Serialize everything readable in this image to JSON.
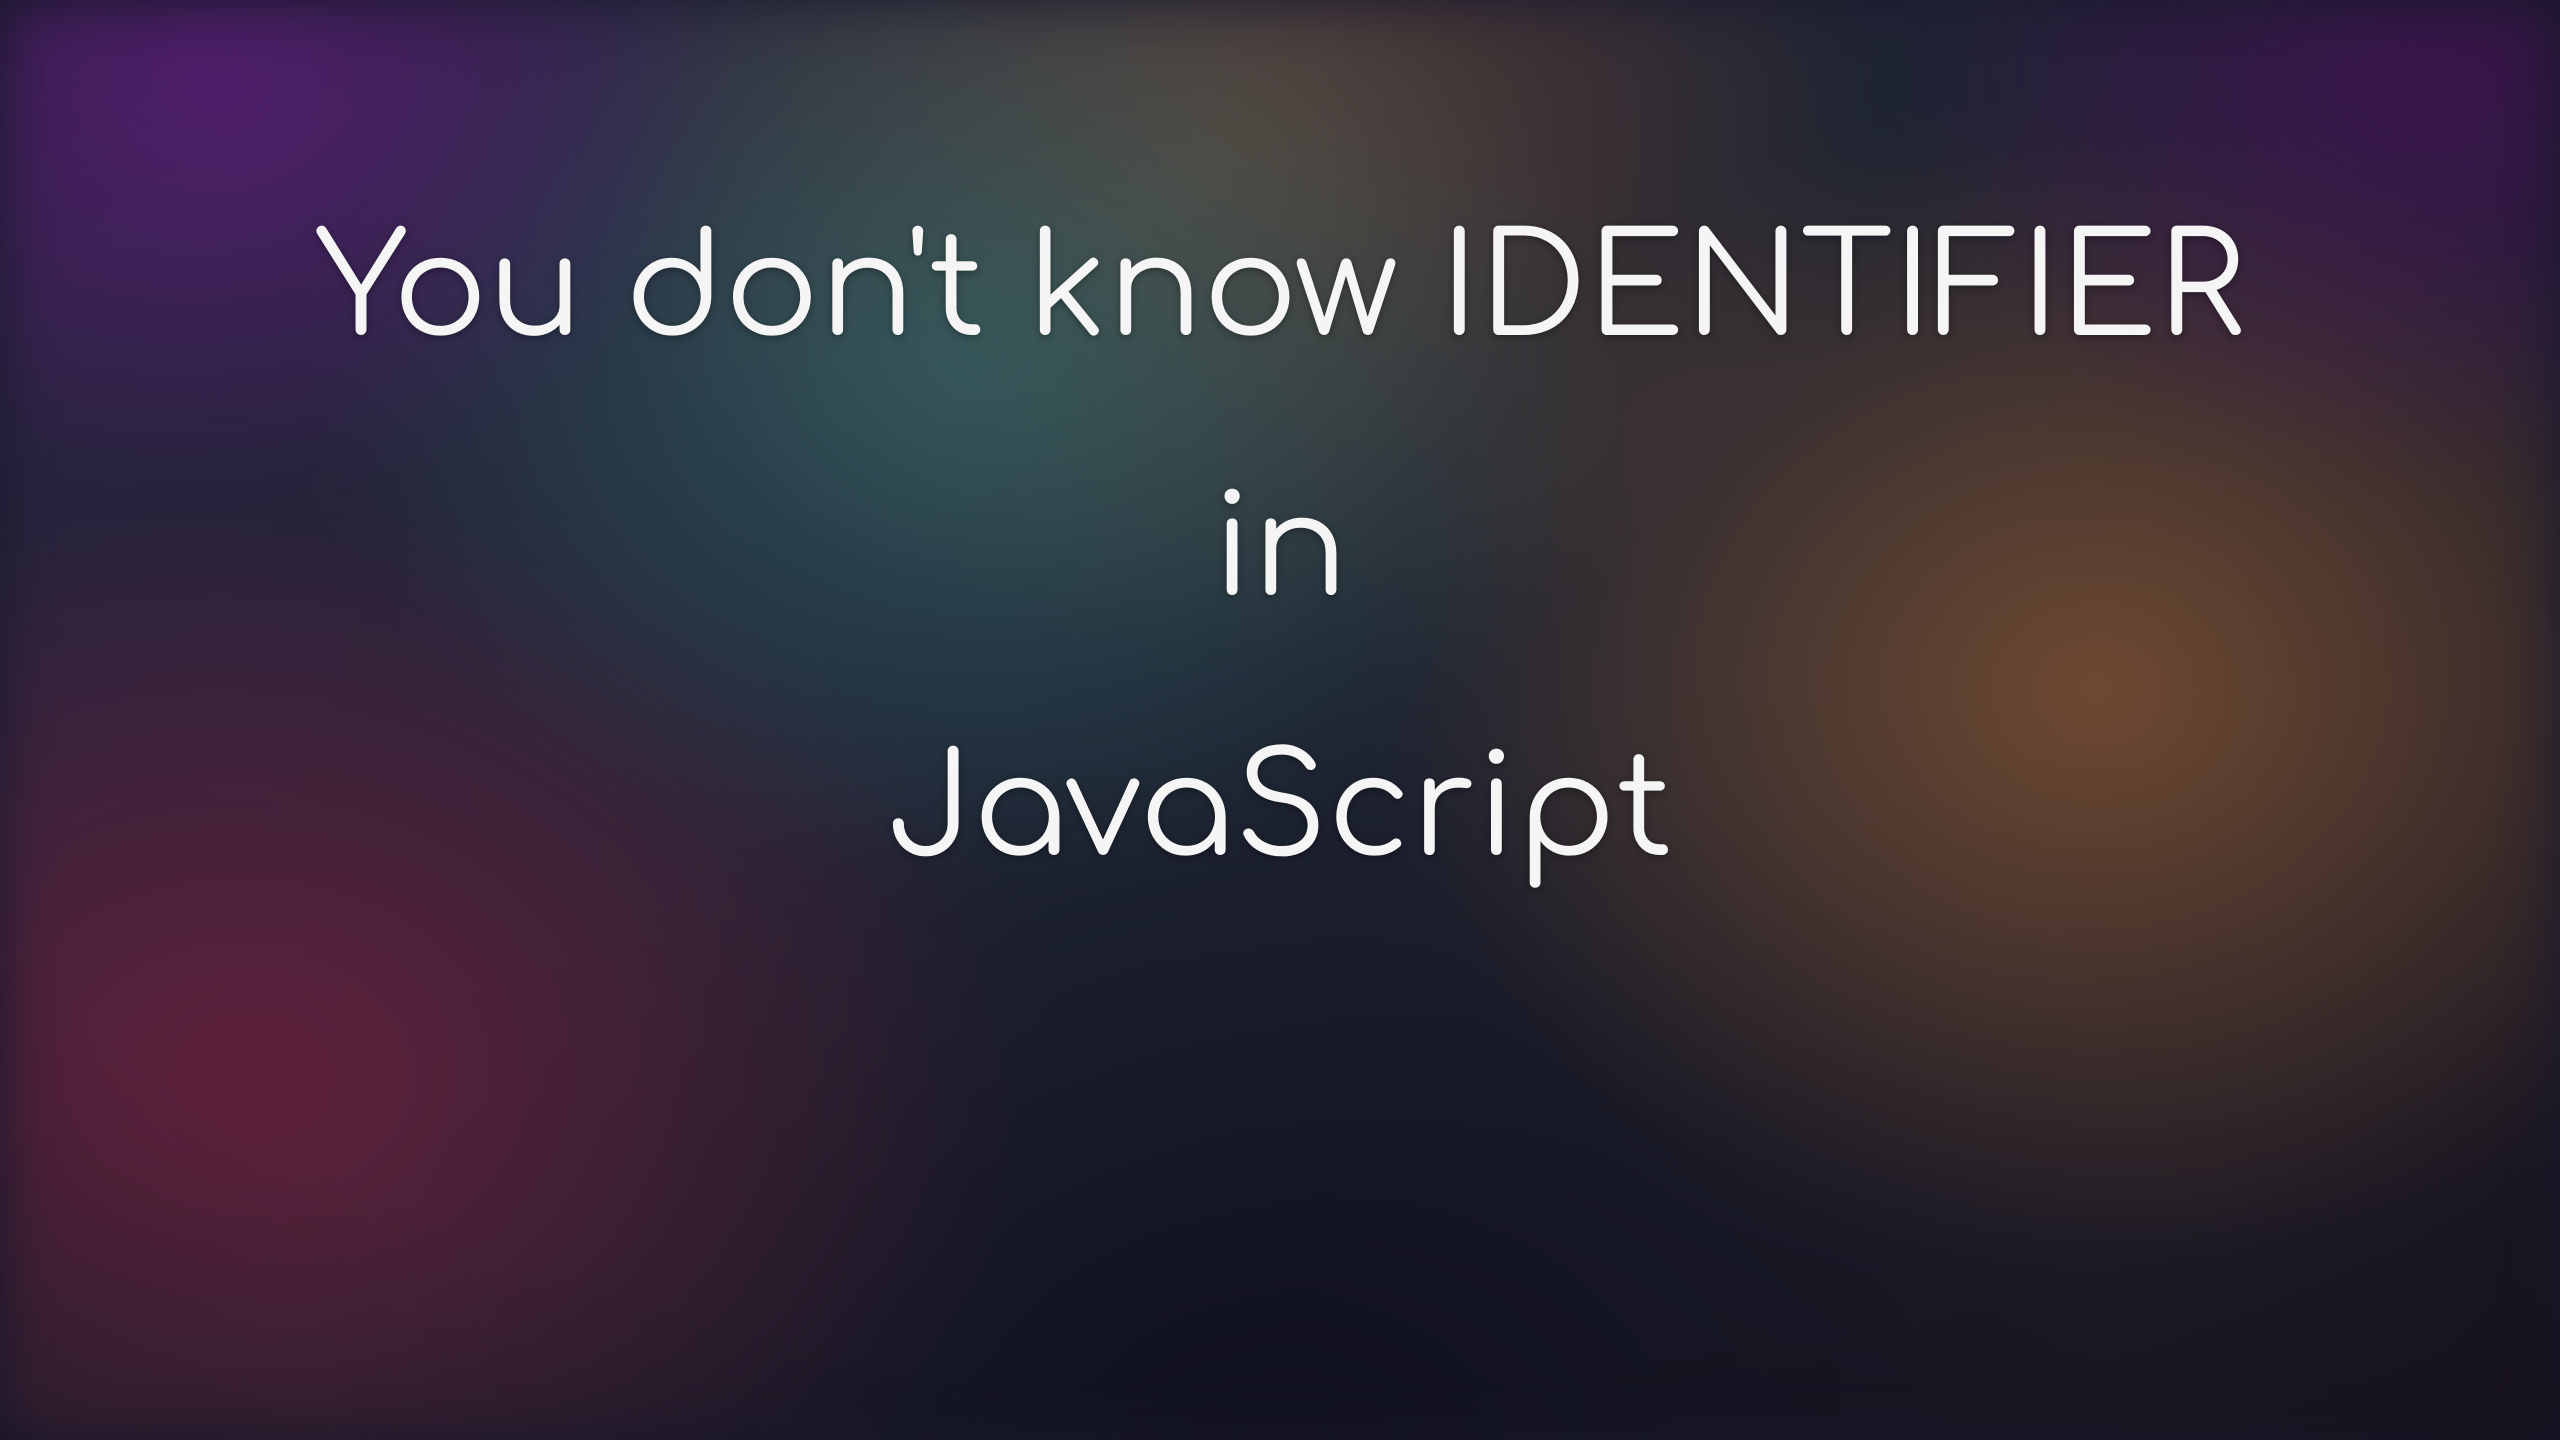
{
  "title": {
    "line1": "You don't know IDENTIFIER",
    "line2": "in",
    "line3": "JavaScript"
  }
}
